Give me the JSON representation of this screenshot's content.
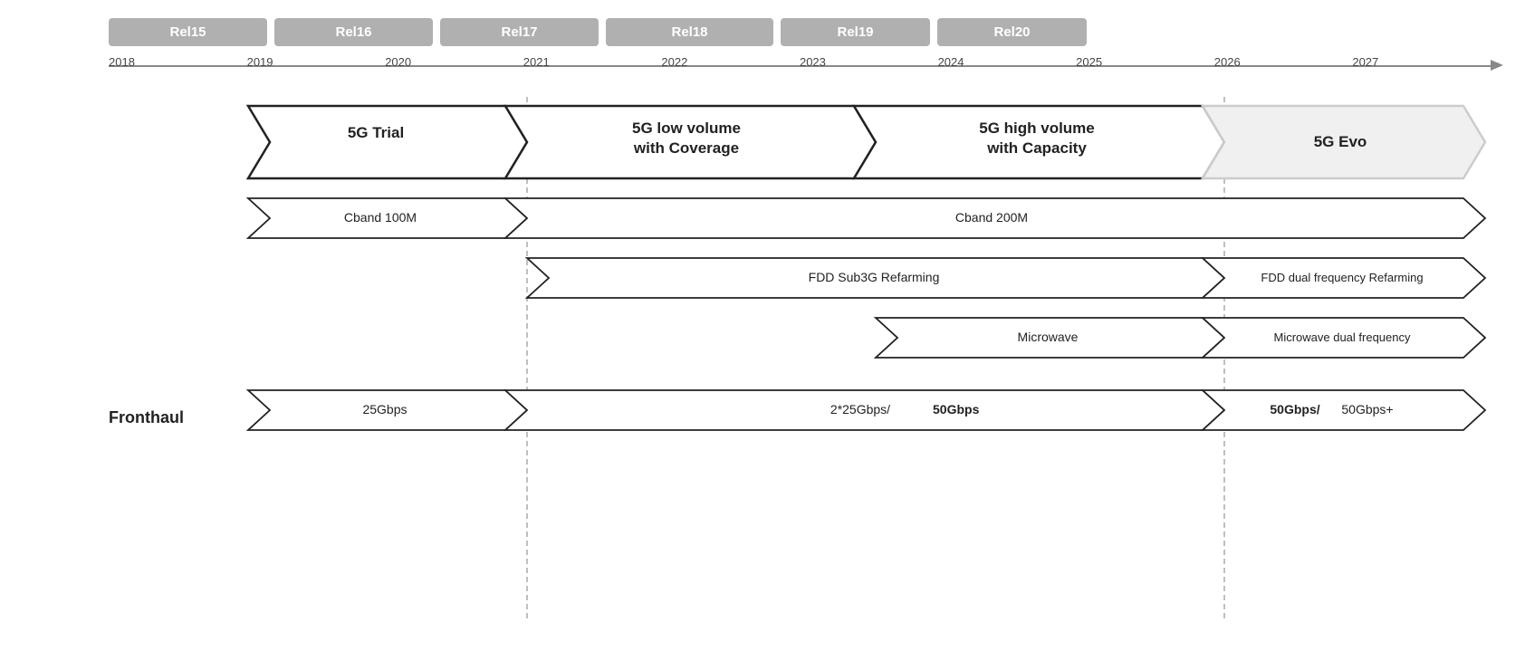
{
  "releases": [
    {
      "label": "Rel15"
    },
    {
      "label": "Rel16"
    },
    {
      "label": "Rel17"
    },
    {
      "label": "Rel18"
    },
    {
      "label": "Rel19"
    },
    {
      "label": "Rel20"
    }
  ],
  "years": [
    "2018",
    "2019",
    "2020",
    "2021",
    "2022",
    "2023",
    "2024",
    "2025",
    "2026",
    "2027"
  ],
  "phases": {
    "trial": "5G Trial",
    "low_volume": "5G low volume\nwith Coverage",
    "high_volume": "5G high volume\nwith Capacity",
    "evo": "5G Evo"
  },
  "rows": {
    "cband100": "Cband 100M",
    "cband200": "Cband 200M",
    "fdd_sub3g": "FDD Sub3G Refarming",
    "fdd_dual": "FDD dual frequency Refarming",
    "microwave": "Microwave",
    "microwave_dual": "Microwave dual frequency",
    "fronthaul_label": "Fronthaul",
    "fronthaul_25": "25Gbps",
    "fronthaul_50": "2*25Gbps/",
    "fronthaul_50b": "50Gbps",
    "fronthaul_final": "50Gbps/",
    "fronthaul_plus": " 50Gbps+"
  },
  "colors": {
    "release_bar": "#b0b0b0",
    "border": "#222",
    "dashed": "#aaa",
    "arrow_fill": "#fff",
    "text": "#222",
    "gray_fill": "#e0e0e0"
  }
}
